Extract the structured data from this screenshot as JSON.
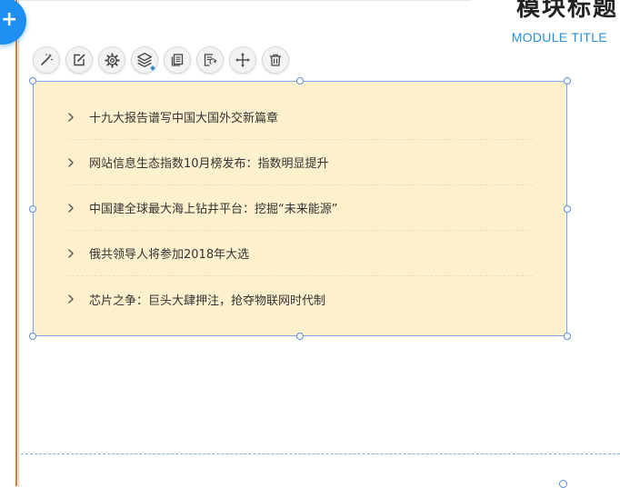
{
  "module": {
    "title": "模块标题",
    "subtitle": "MODULE TITLE"
  },
  "fab": {
    "icon": "plus-icon"
  },
  "toolbar": {
    "buttons": [
      {
        "icon": "magic-wand-icon"
      },
      {
        "icon": "edit-icon"
      },
      {
        "icon": "gear-icon"
      },
      {
        "icon": "layers-icon"
      },
      {
        "icon": "copy-icon"
      },
      {
        "icon": "replace-icon"
      },
      {
        "icon": "move-icon"
      },
      {
        "icon": "trash-icon"
      }
    ]
  },
  "news": {
    "items": [
      {
        "title": "十九大报告谱写中国大国外交新篇章"
      },
      {
        "title": "网站信息生态指数10月榜发布：指数明显提升"
      },
      {
        "title": "中国建全球最大海上钻井平台：挖掘“未来能源”"
      },
      {
        "title": "俄共领导人将参加2018年大选"
      },
      {
        "title": "芯片之争：巨头大肆押注，抢夺物联网时代制"
      }
    ]
  },
  "colors": {
    "accent": "#1e8ef0",
    "selection_border": "#7aa8e8",
    "module_background": "#fdf0cc",
    "guide_line": "#e0772a",
    "subtitle": "#2790dc"
  }
}
